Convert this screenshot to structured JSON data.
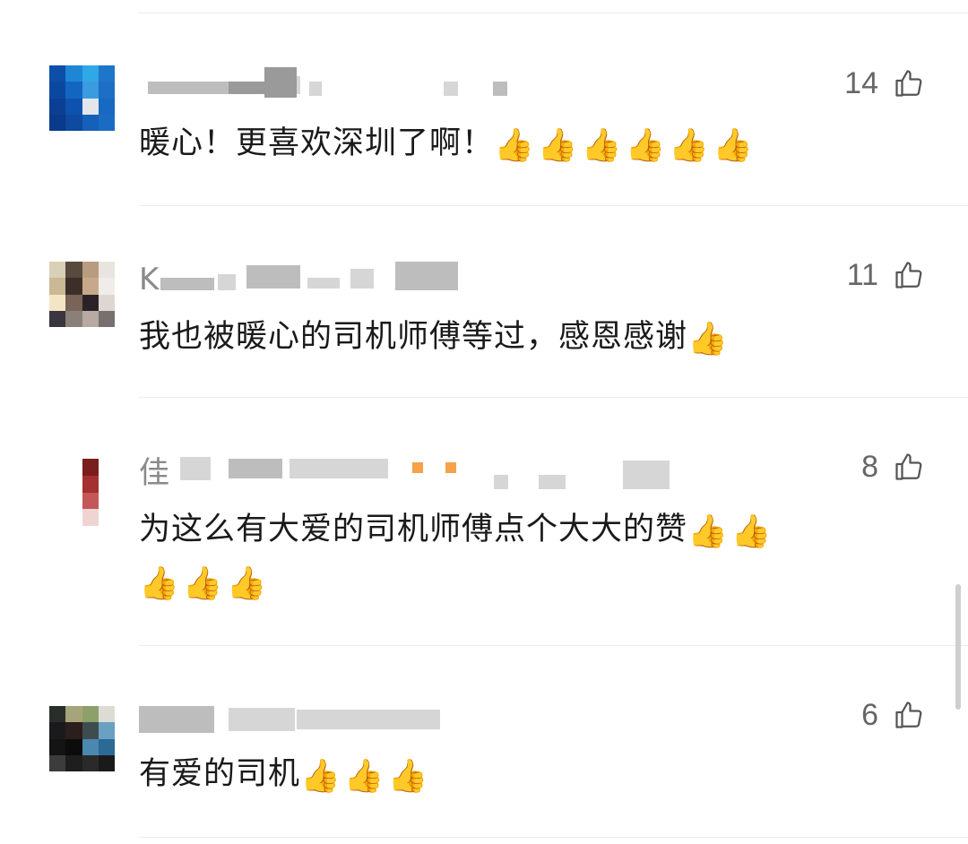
{
  "comments": [
    {
      "name": "",
      "likes": "14",
      "body": "暖心！更喜欢深圳了啊！",
      "emoji": "👍👍👍👍👍👍",
      "like_icon": "thumbs-up-outline-icon"
    },
    {
      "name": "K",
      "likes": "11",
      "body": "我也被暖心的司机师傅等过，感恩感谢",
      "emoji": "👍",
      "like_icon": "thumbs-up-outline-icon"
    },
    {
      "name": "佳",
      "likes": "8",
      "body": "为这么有大爱的司机师傅点个大大的赞",
      "emoji": "👍👍",
      "emoji_line2": "👍👍👍",
      "like_icon": "thumbs-up-outline-icon"
    },
    {
      "name": "",
      "likes": "6",
      "body": "有爱的司机",
      "emoji": "👍👍👍",
      "like_icon": "thumbs-up-outline-icon"
    }
  ]
}
